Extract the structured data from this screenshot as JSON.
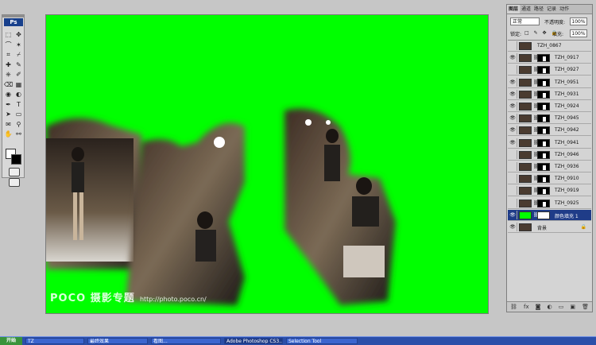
{
  "app": {
    "badge": "Ps"
  },
  "toolbox": {
    "tools": [
      "marquee-tool",
      "move-tool",
      "lasso-tool",
      "magic-wand-tool",
      "crop-tool",
      "slice-tool",
      "healing-brush-tool",
      "brush-tool",
      "clone-stamp-tool",
      "history-brush-tool",
      "eraser-tool",
      "gradient-tool",
      "blur-tool",
      "dodge-tool",
      "pen-tool",
      "type-tool",
      "path-selection-tool",
      "shape-tool",
      "notes-tool",
      "eyedropper-tool",
      "hand-tool",
      "zoom-tool"
    ]
  },
  "document": {
    "canvas_color": "#00ff00",
    "watermark_brand": "POCO 摄影专题",
    "watermark_url": "http://photo.poco.cn/"
  },
  "layers_panel": {
    "tabs": [
      "图层",
      "通道",
      "路径",
      "记录",
      "动作"
    ],
    "blend_mode": "正常",
    "opacity_label": "不透明度:",
    "opacity_value": "100%",
    "lock_label": "锁定:",
    "lock_icons": "□ ✎ ✥ 🔒",
    "fill_label": "填充:",
    "fill_value": "100%",
    "layers": [
      {
        "name": "TZH_0867",
        "visible": false,
        "has_mask": false,
        "selected": false
      },
      {
        "name": "TZH_0917",
        "visible": true,
        "has_mask": true,
        "selected": false
      },
      {
        "name": "TZH_0927",
        "visible": false,
        "has_mask": true,
        "selected": false
      },
      {
        "name": "TZH_0951",
        "visible": true,
        "has_mask": true,
        "selected": false
      },
      {
        "name": "TZH_0931",
        "visible": true,
        "has_mask": true,
        "selected": false
      },
      {
        "name": "TZH_0924",
        "visible": true,
        "has_mask": true,
        "selected": false
      },
      {
        "name": "TZH_0945",
        "visible": true,
        "has_mask": true,
        "selected": false
      },
      {
        "name": "TZH_0942",
        "visible": true,
        "has_mask": true,
        "selected": false
      },
      {
        "name": "TZH_0941",
        "visible": true,
        "has_mask": true,
        "selected": false
      },
      {
        "name": "TZH_0946",
        "visible": false,
        "has_mask": true,
        "selected": false
      },
      {
        "name": "TZH_0936",
        "visible": false,
        "has_mask": true,
        "selected": false
      },
      {
        "name": "TZH_0910",
        "visible": false,
        "has_mask": true,
        "selected": false
      },
      {
        "name": "TZH_0919",
        "visible": false,
        "has_mask": true,
        "selected": false
      },
      {
        "name": "TZH_0925",
        "visible": false,
        "has_mask": true,
        "selected": false
      },
      {
        "name": "颜色填充 1",
        "visible": true,
        "has_mask": true,
        "selected": true,
        "fill_layer": true
      },
      {
        "name": "背景",
        "visible": true,
        "has_mask": false,
        "selected": false,
        "background": true
      }
    ],
    "footer_icons": [
      "link-icon",
      "fx-icon",
      "mask-icon",
      "adjustment-icon",
      "group-icon",
      "new-layer-icon",
      "trash-icon"
    ]
  },
  "taskbar": {
    "start_label": "开始",
    "items": [
      {
        "label": "TZ",
        "active": false
      },
      {
        "label": "最终效果",
        "active": false
      },
      {
        "label": "看图...",
        "active": false
      },
      {
        "label": "Adobe Photoshop CS3...",
        "active": true
      },
      {
        "label": "Selection Tool",
        "active": false
      }
    ]
  }
}
